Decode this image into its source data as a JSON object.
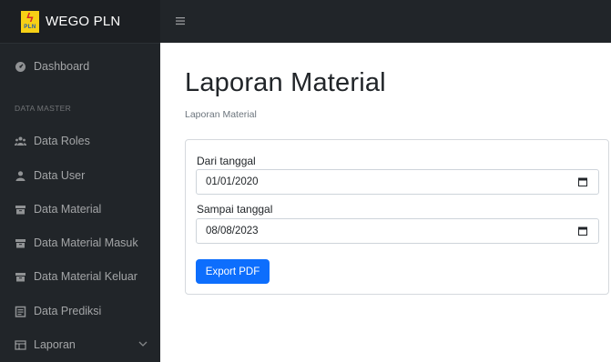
{
  "brand": {
    "name": "WEGO PLN",
    "logo_text": "PLN"
  },
  "sidebar": {
    "dashboard": "Dashboard",
    "section_heading": "DATA MASTER",
    "items": [
      {
        "label": "Data Roles",
        "icon": "users-icon"
      },
      {
        "label": "Data User",
        "icon": "user-icon"
      },
      {
        "label": "Data Material",
        "icon": "archive-icon"
      },
      {
        "label": "Data Material Masuk",
        "icon": "archive-icon"
      },
      {
        "label": "Data Material Keluar",
        "icon": "archive-icon"
      },
      {
        "label": "Data Prediksi",
        "icon": "clipboard-icon"
      },
      {
        "label": "Laporan",
        "icon": "table-icon"
      }
    ]
  },
  "main": {
    "title": "Laporan Material",
    "breadcrumb": "Laporan Material",
    "form": {
      "from_label": "Dari tanggal",
      "from_value": "01/01/2020",
      "to_label": "Sampai tanggal",
      "to_value": "08/08/2023",
      "export_label": "Export PDF"
    }
  },
  "colors": {
    "sidebar_bg": "#212529",
    "primary": "#0d6efd",
    "logo_yellow": "#f6d016"
  }
}
